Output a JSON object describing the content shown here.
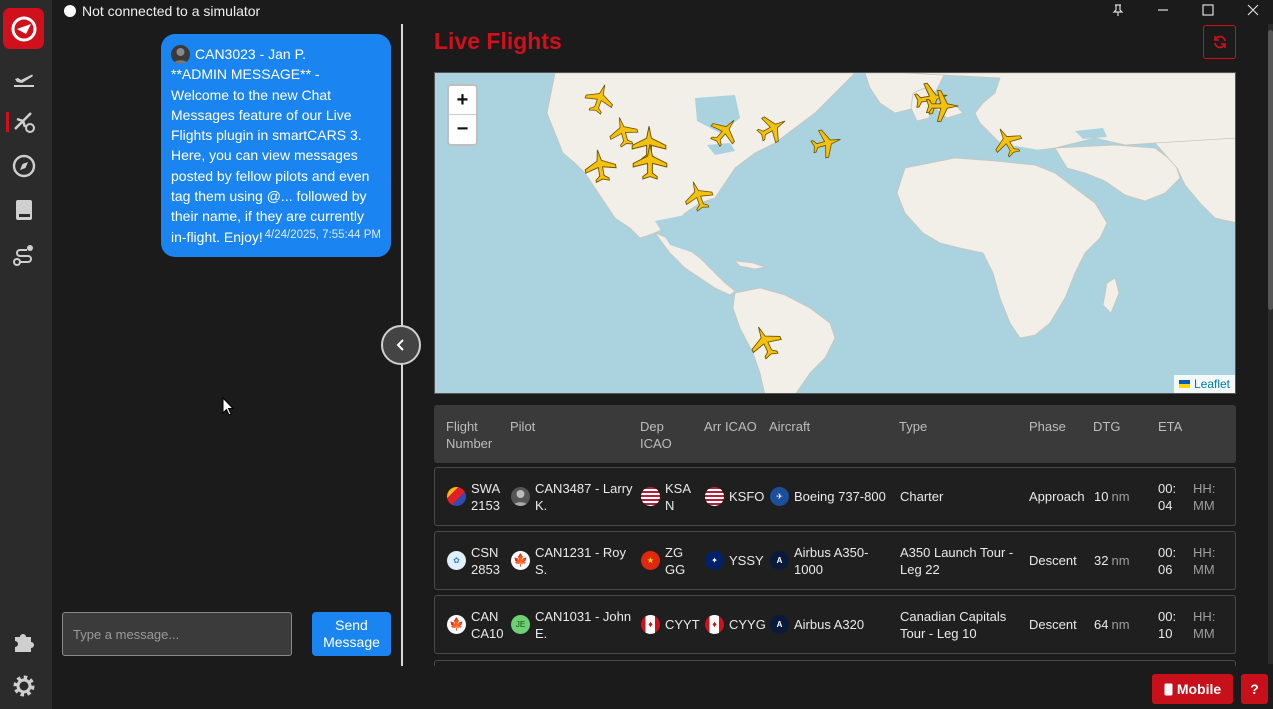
{
  "window": {
    "status_text": "Not connected to a simulator",
    "controls": [
      "pin-icon",
      "minimize-icon",
      "maximize-icon",
      "close-icon"
    ]
  },
  "sidebar": {
    "logo": "smartcars-logo-icon",
    "items": [
      {
        "icon": "plane-departure-icon",
        "active": false
      },
      {
        "icon": "plane-live-icon",
        "active": true
      },
      {
        "icon": "compass-icon",
        "active": false
      },
      {
        "icon": "book-icon",
        "active": false
      },
      {
        "icon": "route-icon",
        "active": false
      }
    ],
    "bottom_items": [
      {
        "icon": "puzzle-icon"
      },
      {
        "icon": "gear-icon"
      }
    ]
  },
  "chat": {
    "messages": [
      {
        "author": "CAN3023 - Jan P.",
        "text": "**ADMIN MESSAGE** - Welcome to the new Chat Messages feature of our Live Flights plugin in smartCARS 3. Here, you can view messages posted by fellow pilots and even tag them using @... followed by their name, if they are currently in-flight. Enjoy!",
        "timestamp": "4/24/2025, 7:55:44 PM"
      }
    ],
    "input_placeholder": "Type a message...",
    "input_value": "",
    "send_label": "Send Message"
  },
  "live_flights": {
    "title": "Live Flights",
    "map": {
      "attribution": "Leaflet",
      "zoom_in": "+",
      "zoom_out": "−"
    },
    "columns": [
      "Flight Number",
      "Pilot",
      "Dep ICAO",
      "Arr ICAO",
      "Aircraft",
      "Type",
      "Phase",
      "DTG",
      "ETA"
    ],
    "rows": [
      {
        "flight": "SWA 2153",
        "airline_color": "#304cb2",
        "pilot": "CAN3487 - Larry K.",
        "dep": "KSAN",
        "dep_flag": "us",
        "arr": "KSFO",
        "arr_flag": "us",
        "aircraft": "Boeing 737-800",
        "mfr": "boeing",
        "type": "Charter",
        "phase": "Approach",
        "dtg": "10",
        "dtg_unit": "nm",
        "eta": "00:04",
        "eta_format": "HH:MM"
      },
      {
        "flight": "CSN2853",
        "airline_color": "#2a7fd4",
        "pilot": "CAN1231 - Roy S.",
        "dep": "ZGGG",
        "dep_flag": "cn",
        "arr": "YSSY",
        "arr_flag": "au",
        "aircraft": "Airbus A350-1000",
        "mfr": "airbus",
        "type": "A350 Launch Tour - Leg 22",
        "phase": "Descent",
        "dtg": "32",
        "dtg_unit": "nm",
        "eta": "00:06",
        "eta_format": "HH:MM"
      },
      {
        "flight": "CAN CA10",
        "airline_color": "#d0101a",
        "pilot": "CAN1031 - John E.",
        "pilot_initials": "JE",
        "dep": "CYYT",
        "dep_flag": "ca",
        "arr": "CYYG",
        "arr_flag": "ca",
        "aircraft": "Airbus A320",
        "mfr": "airbus",
        "type": "Canadian Capitals Tour - Leg 10",
        "phase": "Descent",
        "dtg": "64",
        "dtg_unit": "nm",
        "eta": "00:10",
        "eta_format": "HH:MM"
      }
    ]
  },
  "footer": {
    "mobile_label": "Mobile",
    "help_label": "?"
  },
  "colors": {
    "accent": "#d0101a",
    "chat_bubble": "#1a84f0",
    "map_water": "#aad3df",
    "map_land": "#f2efe9"
  }
}
